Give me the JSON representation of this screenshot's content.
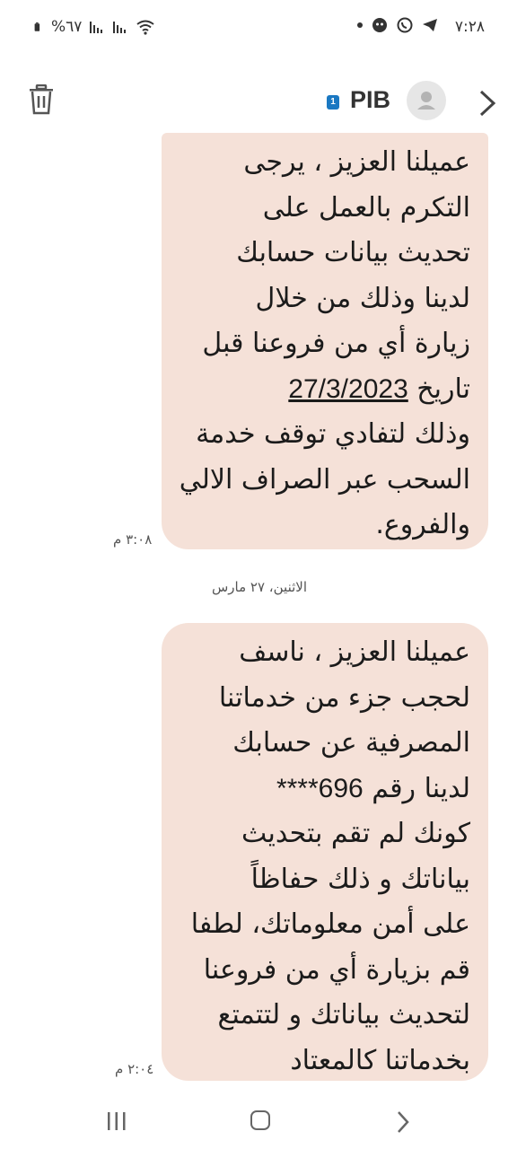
{
  "status_bar": {
    "time": "٧:٢٨",
    "battery": "%٦٧",
    "icons": [
      "telegram-icon",
      "whatsapp-icon",
      "app-icon",
      "wifi-icon",
      "signal-icon",
      "signal-icon",
      "battery-icon"
    ]
  },
  "header": {
    "sim_label": "1",
    "contact_name": "PIB"
  },
  "messages": [
    {
      "lines": [
        "عميلنا العزيز ، يرجى",
        "التكرم بالعمل على",
        "تحديث بيانات حسابك",
        "لدينا وذلك من خلال",
        "زيارة أي من فروعنا قبل"
      ],
      "date_prefix": "تاريخ ",
      "date": "27/3/2023",
      "tail_lines": [
        "وذلك لتفادي توقف خدمة",
        "السحب عبر الصراف الالي",
        "والفروع."
      ],
      "time": "٣:٠٨ م"
    },
    {
      "lines_before": [
        "عميلنا العزيز ، ناسف",
        "لحجب جزء من خدماتنا",
        "المصرفية عن حسابك"
      ],
      "account_prefix": "لدينا رقم ",
      "account": "****696",
      "lines_after": [
        "كونك لم تقم بتحديث",
        "بياناتك و ذلك حفاظاً",
        "على أمن معلوماتك، لطفا",
        "قم بزيارة أي من فروعنا",
        "لتحديث بياناتك و لتتمتع",
        "بخدماتنا كالمعتاد"
      ],
      "time": "٢:٠٤ م"
    }
  ],
  "day_separator": "الاثنين، ٢٧ مارس",
  "colors": {
    "bubble": "#f5e1d8",
    "sim_badge": "#1a78c2"
  }
}
